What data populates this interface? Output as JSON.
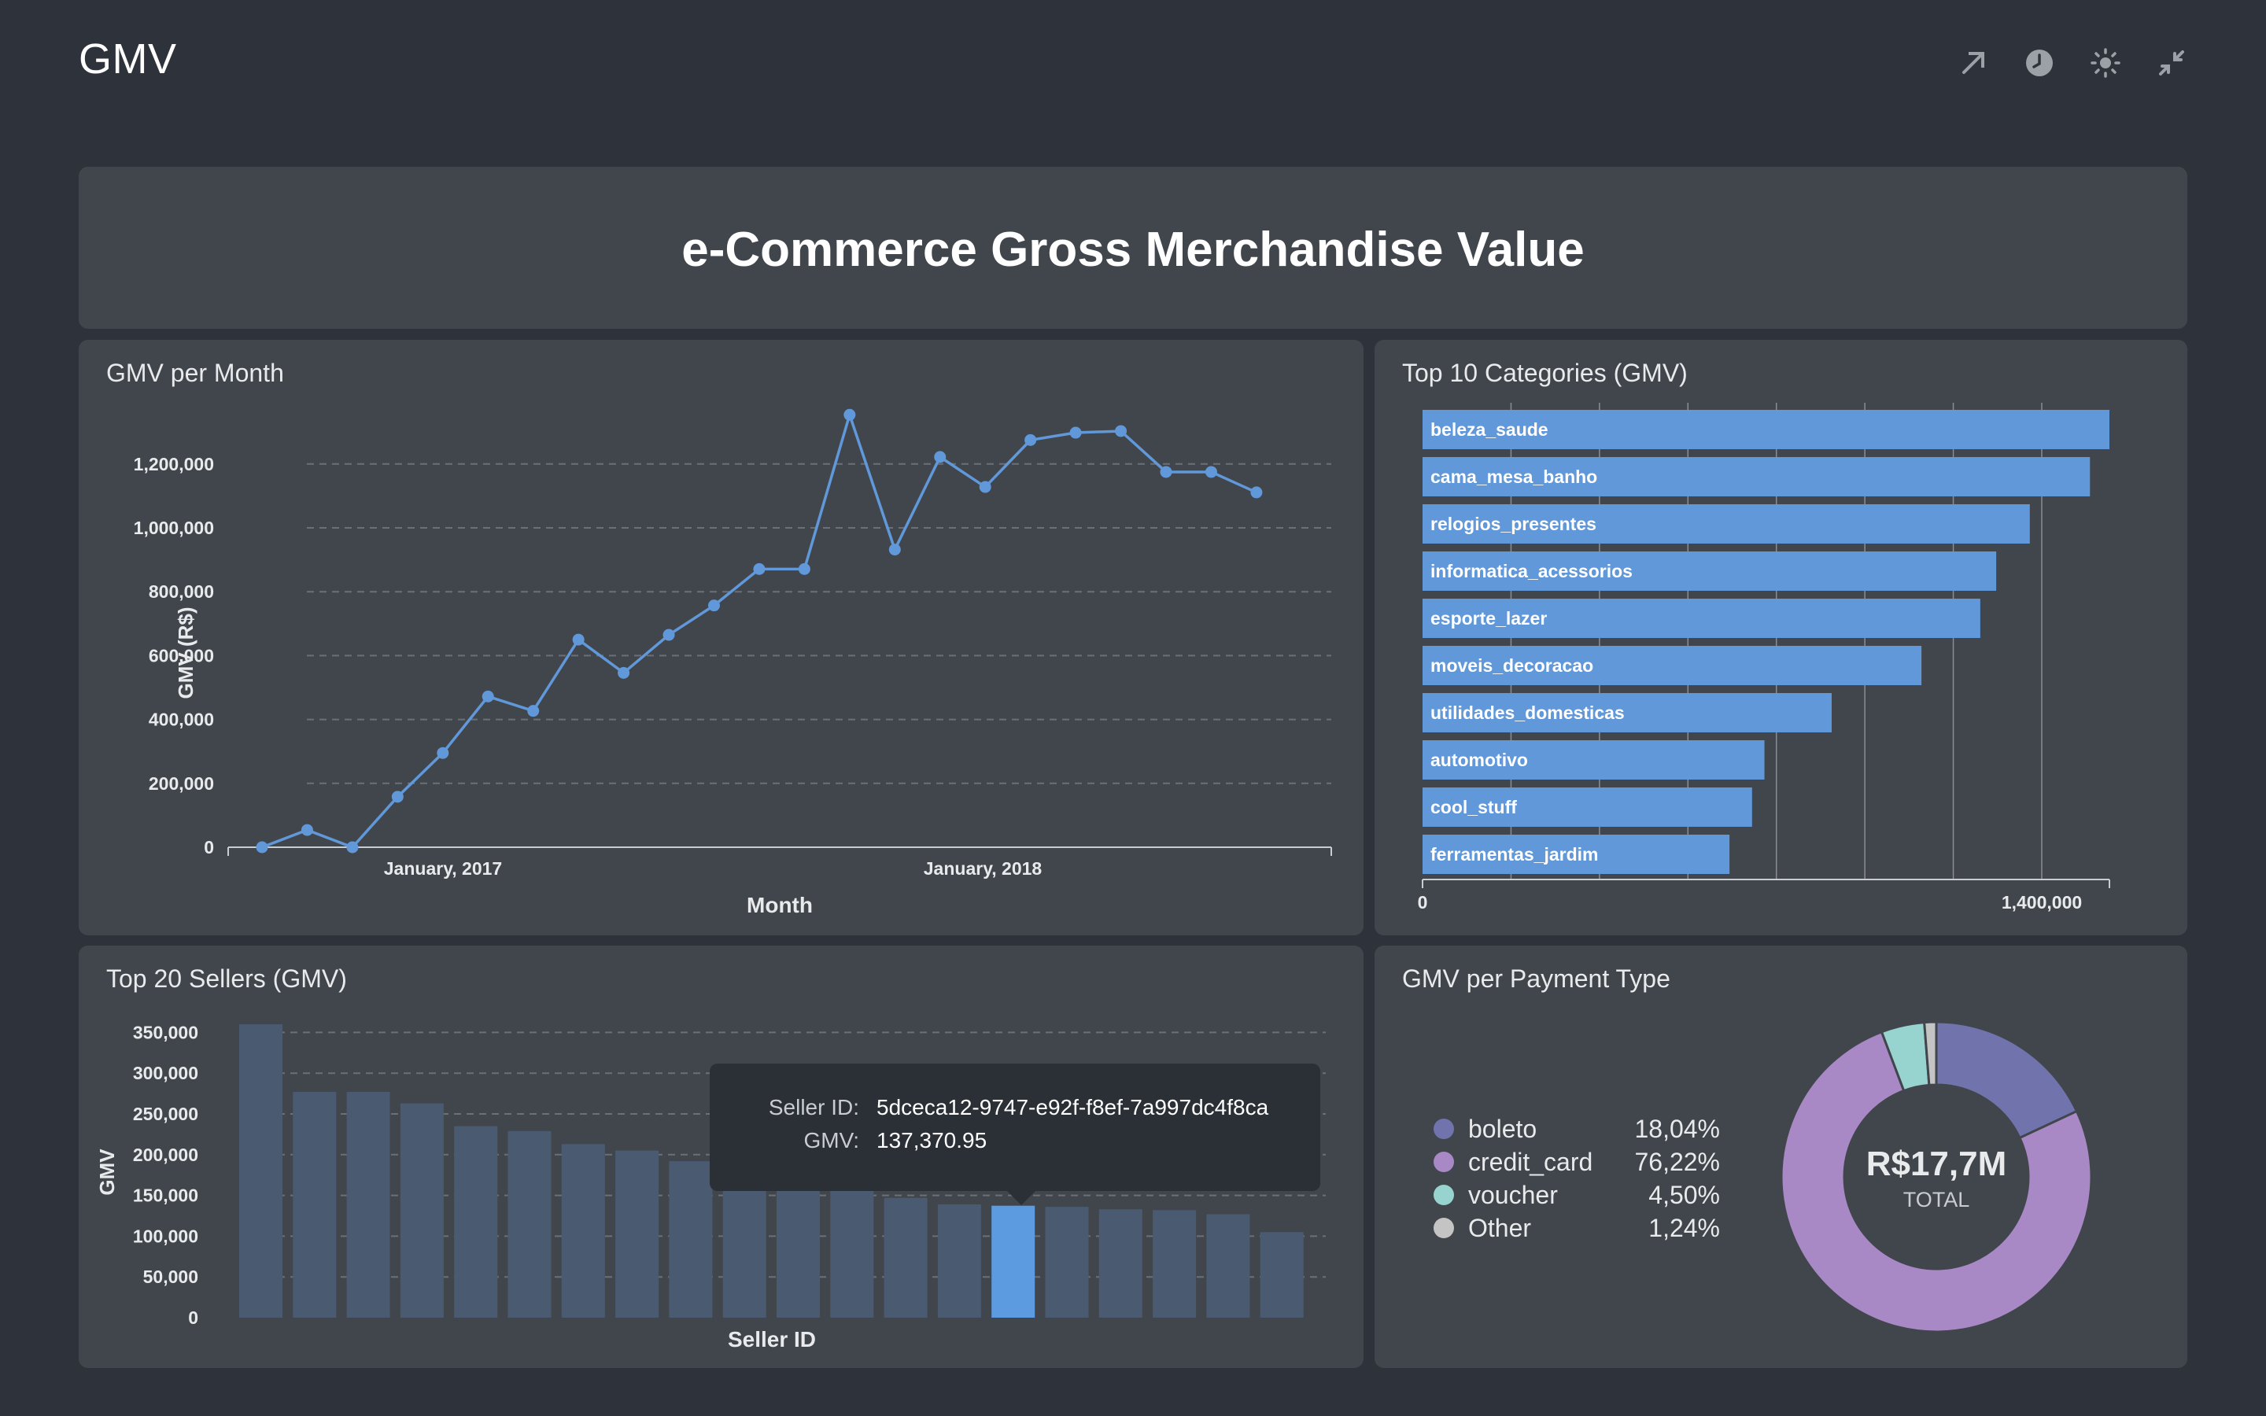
{
  "header": {
    "title": "GMV",
    "actions": [
      {
        "name": "share-icon"
      },
      {
        "name": "history-icon"
      },
      {
        "name": "theme-icon"
      },
      {
        "name": "collapse-icon"
      }
    ]
  },
  "banner": {
    "title": "e-Commerce Gross Merchandise Value"
  },
  "line_card": {
    "title": "GMV per Month",
    "x_tick_labels": [
      "January, 2017",
      "January, 2018"
    ],
    "y_tick_labels": [
      "0",
      "200,000",
      "400,000",
      "600,000",
      "800,000",
      "1,000,000",
      "1,200,000"
    ]
  },
  "hbar_card": {
    "title": "Top 10 Categories (GMV)",
    "x_tick_labels": [
      "0",
      "1,400,000"
    ]
  },
  "vbar_card": {
    "title": "Top 20 Sellers (GMV)",
    "y_tick_labels": [
      "0",
      "50,000",
      "100,000",
      "150,000",
      "200,000",
      "250,000",
      "300,000",
      "350,000"
    ],
    "tooltip": {
      "seller_key": "Seller ID:",
      "seller_value": "5dceca12-9747-e92f-f8ef-7a997dc4f8ca",
      "gmv_key": "GMV:",
      "gmv_value": "137,370.95"
    }
  },
  "donut_card": {
    "title": "GMV per Payment Type",
    "center_value": "R$17,7M",
    "center_label": "TOTAL",
    "legend": [
      {
        "name": "boleto",
        "pct": "18,04%",
        "color": "#7173ad"
      },
      {
        "name": "credit_card",
        "pct": "76,22%",
        "color": "#a989c5"
      },
      {
        "name": "voucher",
        "pct": "4,50%",
        "color": "#98d4cf"
      },
      {
        "name": "Other",
        "pct": "1,24%",
        "color": "#c4c4c4"
      }
    ]
  },
  "chart_data": [
    {
      "type": "line",
      "title": "GMV per Month",
      "xlabel": "Month",
      "ylabel": "GMV (R$)",
      "x": [
        "2016-09",
        "2016-10",
        "2016-12",
        "2017-01",
        "2017-02",
        "2017-03",
        "2017-04",
        "2017-05",
        "2017-06",
        "2017-07",
        "2017-08",
        "2017-09",
        "2017-10",
        "2017-11",
        "2017-12",
        "2018-01",
        "2018-02",
        "2018-03",
        "2018-04",
        "2018-05",
        "2018-06",
        "2018-07",
        "2018-08"
      ],
      "series": [
        {
          "values": [
            0,
            54000,
            0,
            158000,
            295000,
            472000,
            427000,
            650000,
            546000,
            665000,
            757000,
            871000,
            871000,
            1354000,
            932000,
            1222000,
            1128000,
            1275000,
            1298000,
            1303000,
            1175000,
            1175000,
            1111000
          ],
          "color": "#6098d9"
        }
      ],
      "ylim": [
        0,
        1350000
      ],
      "grid": true
    },
    {
      "type": "bar",
      "orientation": "horizontal",
      "title": "Top 10 Categories (GMV)",
      "categories": [
        "beleza_saude",
        "cama_mesa_banho",
        "relogios_presentes",
        "informatica_acessorios",
        "esporte_lazer",
        "moveis_decoracao",
        "utilidades_domesticas",
        "automotivo",
        "cool_stuff",
        "ferramentas_jardim"
      ],
      "values": [
        1553000,
        1509000,
        1373000,
        1297000,
        1261000,
        1128000,
        925000,
        773000,
        745000,
        694000
      ],
      "xlim": [
        0,
        1550000
      ],
      "color": "#6098d9",
      "grid": true
    },
    {
      "type": "bar",
      "title": "Top 20 Sellers (GMV)",
      "xlabel": "Seller ID",
      "ylabel": "GMV",
      "values": [
        360000,
        277000,
        277000,
        263000,
        235000,
        229000,
        213000,
        205000,
        192000,
        186000,
        181000,
        173000,
        147000,
        139000,
        137370.95,
        136000,
        133000,
        132000,
        127000,
        105000
      ],
      "highlighted_index": 14,
      "ylim": [
        0,
        350000
      ],
      "color": "#4a5a70",
      "highlight_color": "#5d9be0",
      "grid": true
    },
    {
      "type": "pie",
      "title": "GMV per Payment Type",
      "labels": [
        "boleto",
        "credit_card",
        "voucher",
        "Other"
      ],
      "values": [
        18.04,
        76.22,
        4.5,
        1.24
      ],
      "colors": [
        "#7173ad",
        "#a989c5",
        "#98d4cf",
        "#c4c4c4"
      ],
      "total_label": "R$17,7M"
    }
  ]
}
